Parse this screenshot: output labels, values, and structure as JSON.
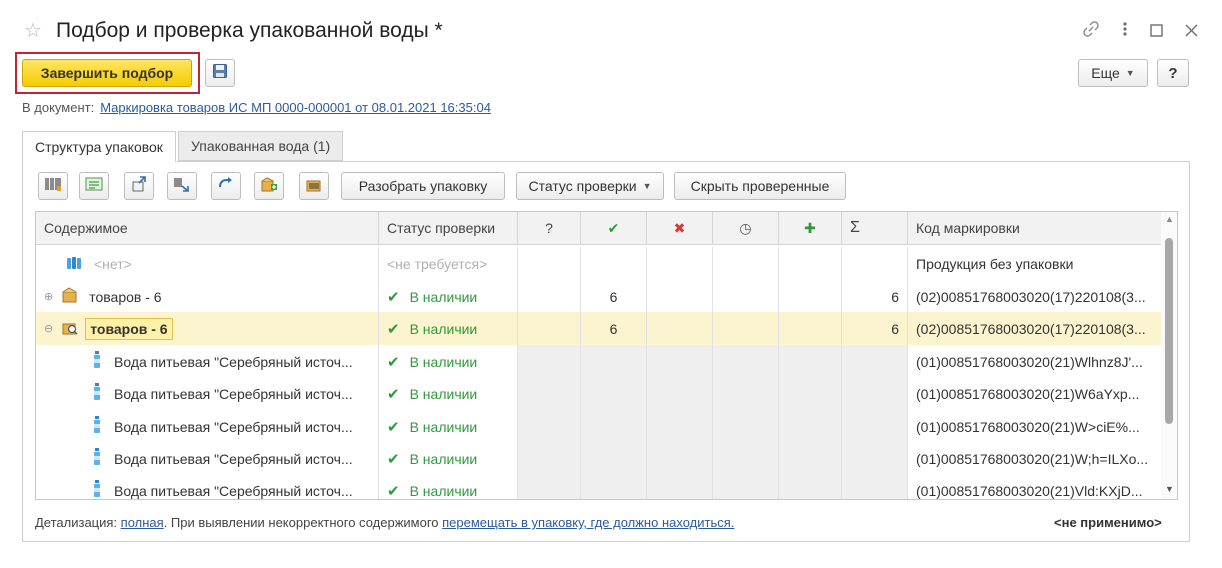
{
  "window": {
    "title": "Подбор и проверка упакованной воды *",
    "star_icon": "star-icon",
    "controls": [
      "link-icon",
      "more-vertical-icon",
      "maximize-icon",
      "close-icon"
    ]
  },
  "toolbar": {
    "finish_label": "Завершить подбор",
    "more_label": "Еще",
    "help_label": "?"
  },
  "document": {
    "label": "В документ:",
    "link": "Маркировка товаров ИС МП 0000-000001 от 08.01.2021 16:35:04"
  },
  "tabs": [
    {
      "label": "Структура упаковок",
      "active": true
    },
    {
      "label": "Упакованная вода (1)",
      "active": false
    }
  ],
  "inner_toolbar": {
    "unpack_label": "Разобрать упаковку",
    "status_label": "Статус проверки",
    "hide_checked_label": "Скрыть проверенные"
  },
  "table": {
    "columns": [
      "Содержимое",
      "Статус проверки",
      "?",
      "✔",
      "✖",
      "◷",
      "✚",
      "Σ",
      "Код маркировки"
    ],
    "rows": [
      {
        "content": "<нет>",
        "status": "<не требуется>",
        "q": "",
        "ok": "",
        "err": "",
        "pend": "",
        "add": "",
        "sum": "",
        "code": "Продукция без упаковки"
      },
      {
        "content": "товаров - 6",
        "status": "В наличии",
        "q": "",
        "ok": "6",
        "err": "",
        "pend": "",
        "add": "",
        "sum": "6",
        "code": "(02)00851768003020(17)220108(3..."
      },
      {
        "content": "товаров - 6",
        "status": "В наличии",
        "q": "",
        "ok": "6",
        "err": "",
        "pend": "",
        "add": "",
        "sum": "6",
        "code": "(02)00851768003020(17)220108(3..."
      },
      {
        "content": "Вода питьевая \"Серебряный источ...",
        "status": "В наличии",
        "q": "",
        "ok": "",
        "err": "",
        "pend": "",
        "add": "",
        "sum": "",
        "code": "(01)00851768003020(21)Wlhnz8J'..."
      },
      {
        "content": "Вода питьевая \"Серебряный источ...",
        "status": "В наличии",
        "q": "",
        "ok": "",
        "err": "",
        "pend": "",
        "add": "",
        "sum": "",
        "code": "(01)00851768003020(21)W6aYxp..."
      },
      {
        "content": "Вода питьевая \"Серебряный источ...",
        "status": "В наличии",
        "q": "",
        "ok": "",
        "err": "",
        "pend": "",
        "add": "",
        "sum": "",
        "code": "(01)00851768003020(21)W>ciE%..."
      },
      {
        "content": "Вода питьевая \"Серебряный источ...",
        "status": "В наличии",
        "q": "",
        "ok": "",
        "err": "",
        "pend": "",
        "add": "",
        "sum": "",
        "code": "(01)00851768003020(21)W;h=ILXo..."
      },
      {
        "content": "Вода питьевая \"Серебряный источ...",
        "status": "В наличии",
        "q": "",
        "ok": "",
        "err": "",
        "pend": "",
        "add": "",
        "sum": "",
        "code": "(01)00851768003020(21)Vld:KXjD..."
      }
    ]
  },
  "footer": {
    "detail_label": "Детализация:",
    "detail_link": "полная",
    "sentence": ". При выявлении некорректного содержимого",
    "move_link": "перемещать в упаковку, где должно находиться.",
    "right_value": "<не применимо>"
  },
  "colors": {
    "finish_button": "#f4cd00",
    "highlight_frame": "#c0262f",
    "selected_row": "#fcf3cf",
    "ok_green": "#2f9a3c",
    "err_red": "#d23a3a",
    "link_blue": "#2a5aa0"
  }
}
